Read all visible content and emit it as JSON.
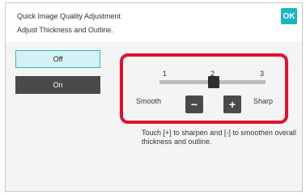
{
  "header": {
    "title_line1": "Quick Image Quality Adjustment",
    "title_line2": "Adjust Thickness and Outline.",
    "ok_label": "OK"
  },
  "options": {
    "off_label": "Off",
    "on_label": "On",
    "selected": "Off"
  },
  "adjuster": {
    "ticks": [
      "1",
      "2",
      "3"
    ],
    "value": 2,
    "left_label": "Smooth",
    "right_label": "Sharp",
    "minus_label": "−",
    "plus_label": "+"
  },
  "hint_text": "Touch [+] to sharpen and [-] to smoothen overall thickness and outline.",
  "colors": {
    "accent": "#19b7c6",
    "highlight": "#e3102d",
    "dark_button": "#4a4a4a"
  }
}
